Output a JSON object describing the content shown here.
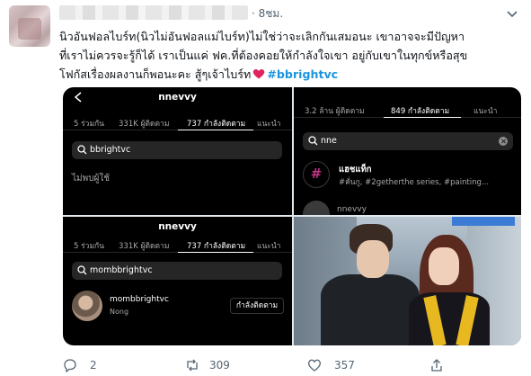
{
  "tweet": {
    "time": "· 8ชม.",
    "text_lines": [
      "นิวอันฟอลไบร์ท(นิวไม่อันฟอลแม่ไบร์ท)ไม่ใช่ว่าจะเลิกกันเสมอนะ เขาอาจจะมีปัญหา",
      "ที่เราไม่ควรจะรู้ก็ได้ เราเป็นแค่ ฟค.ที่ต้องคอยให้กำลังใจเขา อยู่กับเขาในทุกข์หรือสุข",
      "โฟกัสเรื่องผลงานก็พอนะคะ สู้ๆเจ้าไบร์ท"
    ],
    "hashtag": "#bbrightvc",
    "actions": {
      "reply_count": "2",
      "retweet_count": "309",
      "like_count": "357"
    }
  },
  "media": {
    "panel1": {
      "username": "nnevvy",
      "tabs": [
        "5 ร่วมกัน",
        "331K ผู้ติดตาม",
        "737 กำลังติดตาม",
        "แนะนำ"
      ],
      "search_query": "bbrightvc",
      "no_result": "ไม่พบผู้ใช้"
    },
    "panel2": {
      "tabs": [
        "3.2 ล้าน ผู้ติดตาม",
        "849 กำลังติดตาม",
        "แนะนำ"
      ],
      "search_query": "nne",
      "hashtag_title": "แฮชแท็ก",
      "hashtag_sub": "#คั่นกู, #2getherthe series, #painting...",
      "cut_username": "nnevvy"
    },
    "panel3": {
      "username": "nnevvy",
      "tabs": [
        "5 ร่วมกัน",
        "331K ผู้ติดตาม",
        "737 กำลังติดตาม",
        "แนะนำ"
      ],
      "search_query": "mombbrightvc",
      "result_name": "mombbrightvc",
      "result_sub": "Nong",
      "follow_button": "กำลังติดตาม"
    }
  },
  "colors": {
    "hashtag": "#1b95e0",
    "heart": "#e0245e",
    "ig_bg": "#000000"
  }
}
